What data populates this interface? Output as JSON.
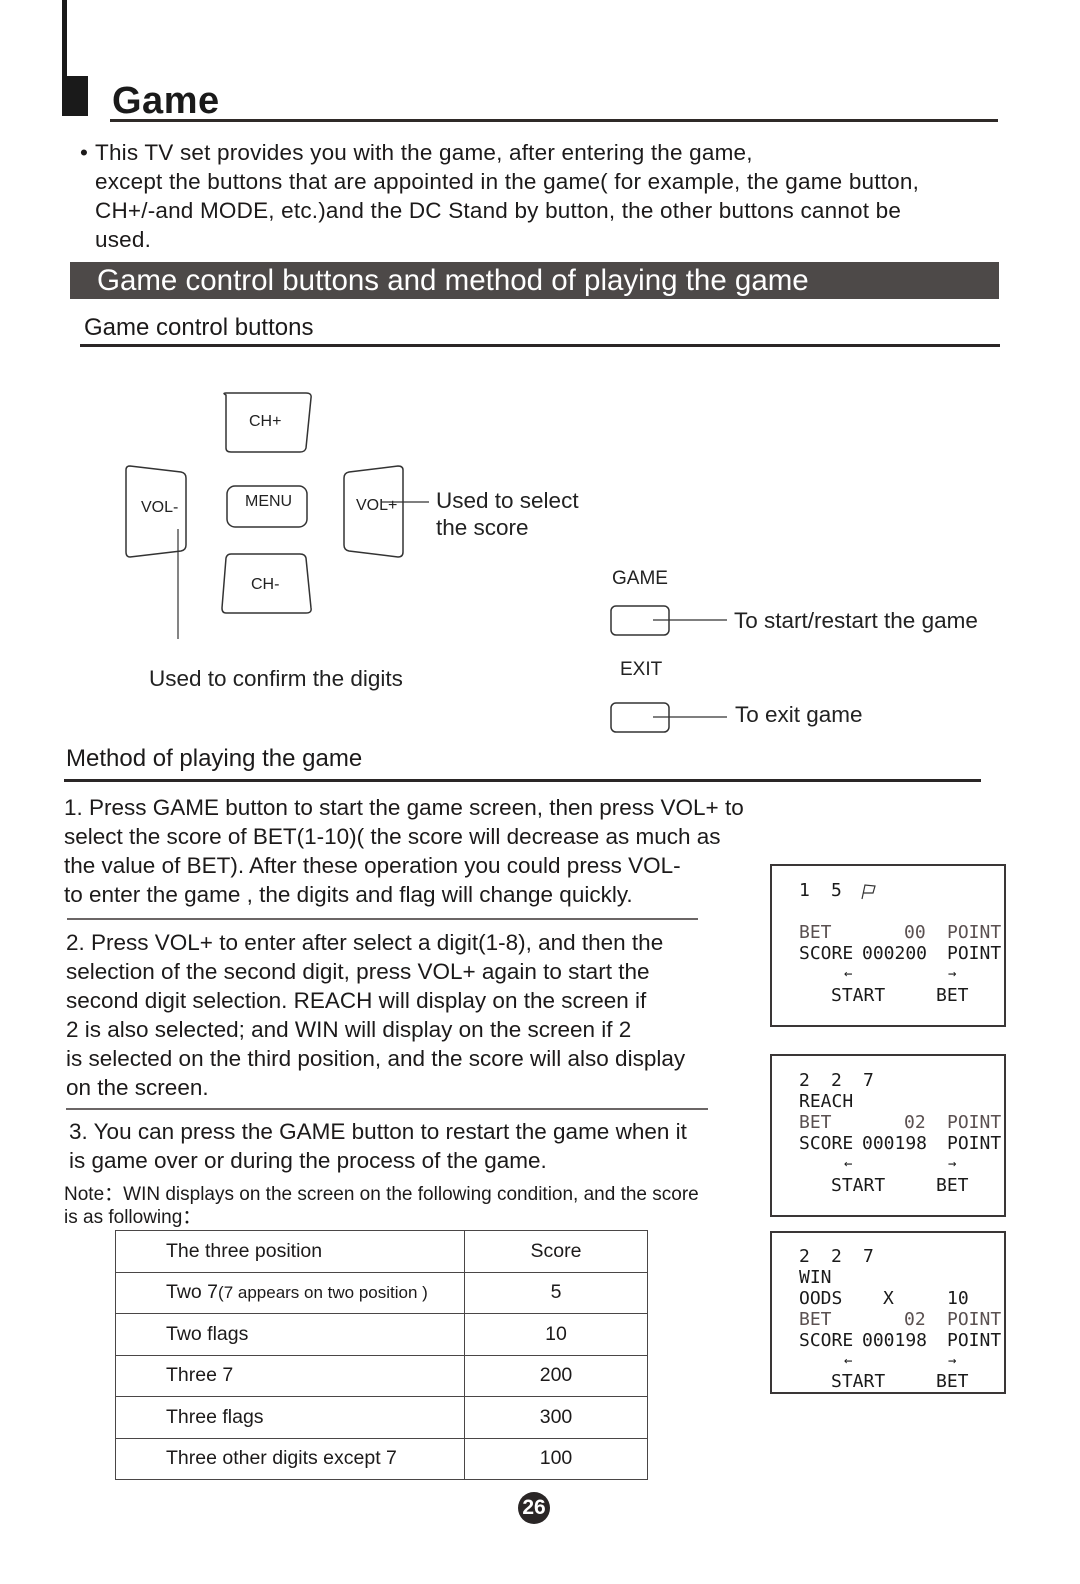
{
  "header": {
    "title": "Game"
  },
  "intro": {
    "bullet": "•",
    "lines": [
      "This TV set provides you with the game, after entering the game,",
      "except the buttons that are appointed in the game( for example, the game button,",
      "CH+/-and MODE, etc.)and the DC Stand by button, the other buttons cannot be",
      "used."
    ]
  },
  "section_title": "Game control buttons and method of playing the game",
  "controls": {
    "heading": "Game control buttons",
    "buttons": {
      "ch_plus": "CH+",
      "ch_minus": "CH-",
      "vol_minus": "VOL-",
      "vol_plus": "VOL+",
      "menu": "MENU",
      "game": "GAME",
      "exit": "EXIT"
    },
    "callouts": {
      "vol_plus_line1": "Used to select",
      "vol_plus_line2": "the score",
      "vol_minus": "Used to confirm the digits",
      "game": "To start/restart the game",
      "exit": "To exit game"
    }
  },
  "method": {
    "heading": "Method of playing the game",
    "step1": [
      "1. Press GAME button to start the game screen, then press VOL+ to",
      "select the score of BET(1-10)( the score will decrease as much as",
      "the value of BET). After these operation you could press VOL-",
      "to enter the game , the digits and flag will change quickly."
    ],
    "step2": [
      "2. Press VOL+ to enter after select a digit(1-8), and then the",
      "selection of the second digit, press VOL+ again to start the",
      "second digit selection. REACH will display on the screen if",
      "2 is also selected; and WIN will display on the screen if 2",
      "is selected on the third position, and the score will also display",
      "on the screen."
    ],
    "step3": [
      "3. You can press the GAME button to restart the game when it",
      "is game over or during the process of the game."
    ],
    "note": [
      "Note：WIN displays on the screen on the following condition, and the score",
      "is as following："
    ]
  },
  "screens": [
    {
      "digits": [
        "1",
        "5"
      ],
      "flag_icon": "flag-icon",
      "status": "",
      "bet_label": "BET",
      "bet_value": "00",
      "bet_unit": "POINT",
      "score_label": "SCORE",
      "score_value": "000200",
      "score_unit": "POINT",
      "left_arrow": "←",
      "right_arrow": "→",
      "start_label": "START",
      "bet_action": "BET"
    },
    {
      "digits": [
        "2",
        "2",
        "7"
      ],
      "status": "REACH",
      "bet_label": "BET",
      "bet_value": "02",
      "bet_unit": "POINT",
      "score_label": "SCORE",
      "score_value": "000198",
      "score_unit": "POINT",
      "left_arrow": "←",
      "right_arrow": "→",
      "start_label": "START",
      "bet_action": "BET"
    },
    {
      "digits": [
        "2",
        "2",
        "7"
      ],
      "status": "WIN",
      "odds_label": "OODS",
      "odds_x": "X",
      "odds_value": "10",
      "bet_label": "BET",
      "bet_value": "02",
      "bet_unit": "POINT",
      "score_label": "SCORE",
      "score_value": "000198",
      "score_unit": "POINT",
      "left_arrow": "←",
      "right_arrow": "→",
      "start_label": "START",
      "bet_action": "BET"
    }
  ],
  "win_table": {
    "headers": [
      "The three position",
      "Score"
    ],
    "rows": [
      {
        "main": "Two 7",
        "detail": "(7 appears on two position )",
        "score": "5"
      },
      {
        "main": "Two flags",
        "detail": "",
        "score": "10"
      },
      {
        "main": "Three 7",
        "detail": "",
        "score": "200"
      },
      {
        "main": "Three flags",
        "detail": "",
        "score": "300"
      },
      {
        "main": "Three other digits except 7",
        "detail": "",
        "score": "100"
      }
    ]
  },
  "page_number": "26"
}
